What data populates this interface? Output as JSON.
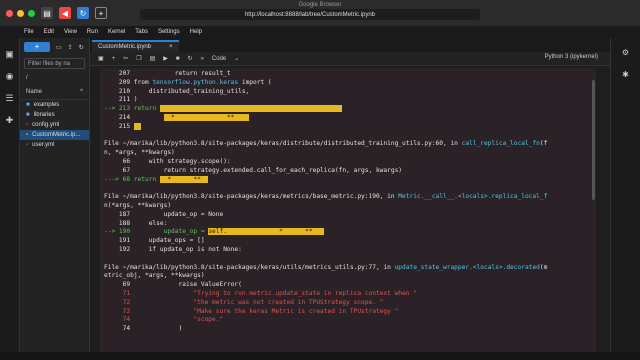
{
  "window": {
    "title": "Google Browser",
    "url": "http://localhost:8888/lab/tree/CustomMetric.ipynb"
  },
  "menu": [
    "File",
    "Edit",
    "View",
    "Run",
    "Kernel",
    "Tabs",
    "Settings",
    "Help"
  ],
  "filebrowser": {
    "filter_placeholder": "Filter files by na",
    "path": "/",
    "header_name": "Name",
    "header_sort": "^",
    "items": [
      {
        "name": "examples",
        "icon": "folder-icon"
      },
      {
        "name": "libraries",
        "icon": "folder-icon"
      },
      {
        "name": "config.yml",
        "icon": "file-icon"
      },
      {
        "name": "CustomMetric.ip...",
        "icon": "notebook-icon"
      },
      {
        "name": "user.yml",
        "icon": "file-icon"
      }
    ]
  },
  "tab": {
    "label": "CustomMetric.ipynb",
    "close": "×"
  },
  "toolbar": {
    "cell_type": "Code",
    "kernel": "Python 3 (ipykernel)"
  },
  "traceback": [
    {
      "segs": [
        {
          "t": "    207            return result_t",
          "c": ""
        }
      ]
    },
    {
      "segs": [
        {
          "t": "    209 from ",
          "c": ""
        },
        {
          "t": "tensorflow.python.keras",
          "c": "cyan"
        },
        {
          "t": " import (",
          "c": ""
        }
      ]
    },
    {
      "segs": [
        {
          "t": "    210     distributed_training_utils,",
          "c": ""
        }
      ]
    },
    {
      "segs": [
        {
          "t": "    211 )",
          "c": ""
        }
      ]
    },
    {
      "segs": [
        {
          "t": "--> 213 return ",
          "c": "green"
        },
        {
          "t": "                                                 ",
          "c": "hl"
        }
      ]
    },
    {
      "segs": [
        {
          "t": "    214         ",
          "c": ""
        },
        {
          "t": "  *              **    ",
          "c": "hl"
        }
      ]
    },
    {
      "segs": [
        {
          "t": "    215 ",
          "c": ""
        },
        {
          "t": "  ",
          "c": "hl"
        }
      ]
    },
    {
      "segs": [
        {
          "t": "",
          "c": ""
        }
      ]
    },
    {
      "segs": [
        {
          "t": "File ~/marika/lib/python3.8/site-packages/keras/distribute/distributed_training_utils.py:60, in ",
          "c": ""
        },
        {
          "t": "call_replica_local_fn",
          "c": "cyan"
        },
        {
          "t": "(f",
          "c": ""
        }
      ]
    },
    {
      "segs": [
        {
          "t": "n, *args, **kwargs)",
          "c": ""
        }
      ]
    },
    {
      "segs": [
        {
          "t": "     66     with strategy.scope():",
          "c": ""
        }
      ]
    },
    {
      "segs": [
        {
          "t": "     67         return strategy.extended.call_for_each_replica(fn, args, kwargs)",
          "c": ""
        }
      ]
    },
    {
      "segs": [
        {
          "t": "---> 68 return ",
          "c": "green"
        },
        {
          "t": "  *      **  ",
          "c": "hl"
        }
      ]
    },
    {
      "segs": [
        {
          "t": "",
          "c": ""
        }
      ]
    },
    {
      "segs": [
        {
          "t": "File ~/marika/lib/python3.8/site-packages/keras/metrics/base_metric.py:190, in ",
          "c": ""
        },
        {
          "t": "Metric.__call__.<locals>.replica_local_f",
          "c": "cyan"
        }
      ]
    },
    {
      "segs": [
        {
          "t": "n(*args, **kwargs)",
          "c": ""
        }
      ]
    },
    {
      "segs": [
        {
          "t": "    187         update_op = None",
          "c": ""
        }
      ]
    },
    {
      "segs": [
        {
          "t": "    188     else:",
          "c": ""
        }
      ]
    },
    {
      "segs": [
        {
          "t": "--> 190         update_op = ",
          "c": "green"
        },
        {
          "t": "self.              *      **   ",
          "c": "hl"
        }
      ]
    },
    {
      "segs": [
        {
          "t": "    191     update_ops = []",
          "c": ""
        }
      ]
    },
    {
      "segs": [
        {
          "t": "    192     if update_op is not None:",
          "c": ""
        }
      ]
    },
    {
      "segs": [
        {
          "t": "",
          "c": ""
        }
      ]
    },
    {
      "segs": [
        {
          "t": "File ~/marika/lib/python3.8/site-packages/keras/utils/metrics_utils.py:77, in ",
          "c": ""
        },
        {
          "t": "update_state_wrapper.<locals>.decorated",
          "c": "cyan"
        },
        {
          "t": "(m",
          "c": ""
        }
      ]
    },
    {
      "segs": [
        {
          "t": "etric_obj, *args, **kwargs)",
          "c": ""
        }
      ]
    },
    {
      "segs": [
        {
          "t": "     69             raise ValueError(",
          "c": ""
        }
      ]
    },
    {
      "segs": [
        {
          "t": "     71                 \"Trying to run metric.update_state in replica context when \"",
          "c": "red"
        }
      ]
    },
    {
      "segs": [
        {
          "t": "     72                 \"the metric was not created in TPUStrategy scope. \"",
          "c": "red"
        }
      ]
    },
    {
      "segs": [
        {
          "t": "     73                 \"Make sure the keras Metric is created in TPUstrategy \"",
          "c": "red"
        }
      ]
    },
    {
      "segs": [
        {
          "t": "     74                 \"scope.\"",
          "c": "red"
        }
      ]
    },
    {
      "segs": [
        {
          "t": "     74             )",
          "c": ""
        }
      ]
    }
  ]
}
